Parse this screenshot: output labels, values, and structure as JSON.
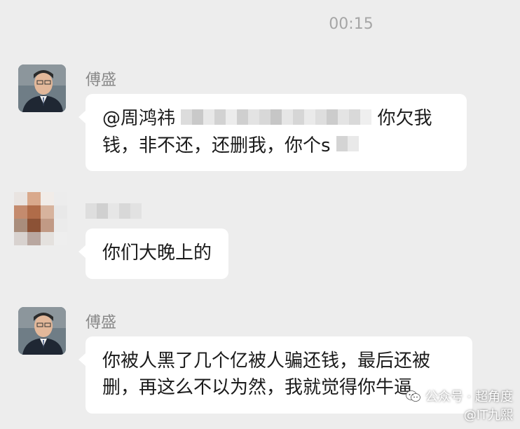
{
  "timestamp": "00:15",
  "messages": [
    {
      "sender": "傅盛",
      "text_line1_prefix": "@周鸿祎",
      "text_line1_suffix": "你欠我",
      "text_line2": "钱，非不还，还删我，你个s"
    },
    {
      "sender": "",
      "text": "你们大晚上的"
    },
    {
      "sender": "傅盛",
      "text_line1": "你被人黑了几个亿被人骗还钱，最后还被",
      "text_line2": "删，再这么不以为然，我就觉得你牛逼"
    }
  ],
  "watermark": {
    "line1": "公众号 · 超角度",
    "line2": "@IT九熙"
  },
  "colors": {
    "background": "#ededed",
    "bubble": "#ffffff",
    "sender_name": "#8a8a8a",
    "timestamp": "#a6a6a6"
  }
}
